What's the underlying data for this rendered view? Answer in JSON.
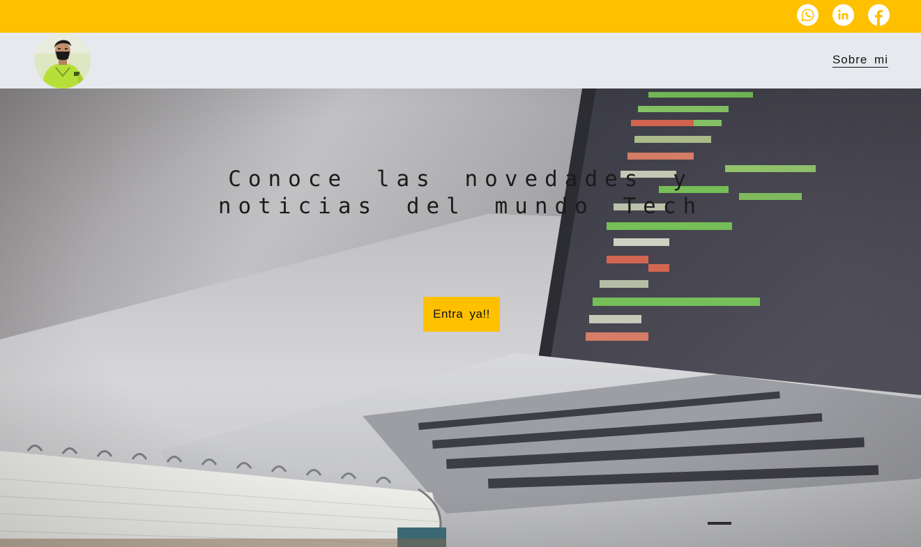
{
  "topbar": {
    "background": "#ffc000",
    "social_icons": [
      "whatsapp-icon",
      "linkedin-icon",
      "facebook-icon"
    ]
  },
  "navbar": {
    "background": "#e6e9ed",
    "avatar": "profile-photo",
    "links": [
      {
        "label": "Sobre  mi"
      }
    ]
  },
  "hero": {
    "background": "laptop-code-photo",
    "title_line1": "Conoce las novedades y",
    "title_line2": "noticias del mundo Tech",
    "cta_label": "Entra  ya!!",
    "cta_color": "#ffc000"
  }
}
